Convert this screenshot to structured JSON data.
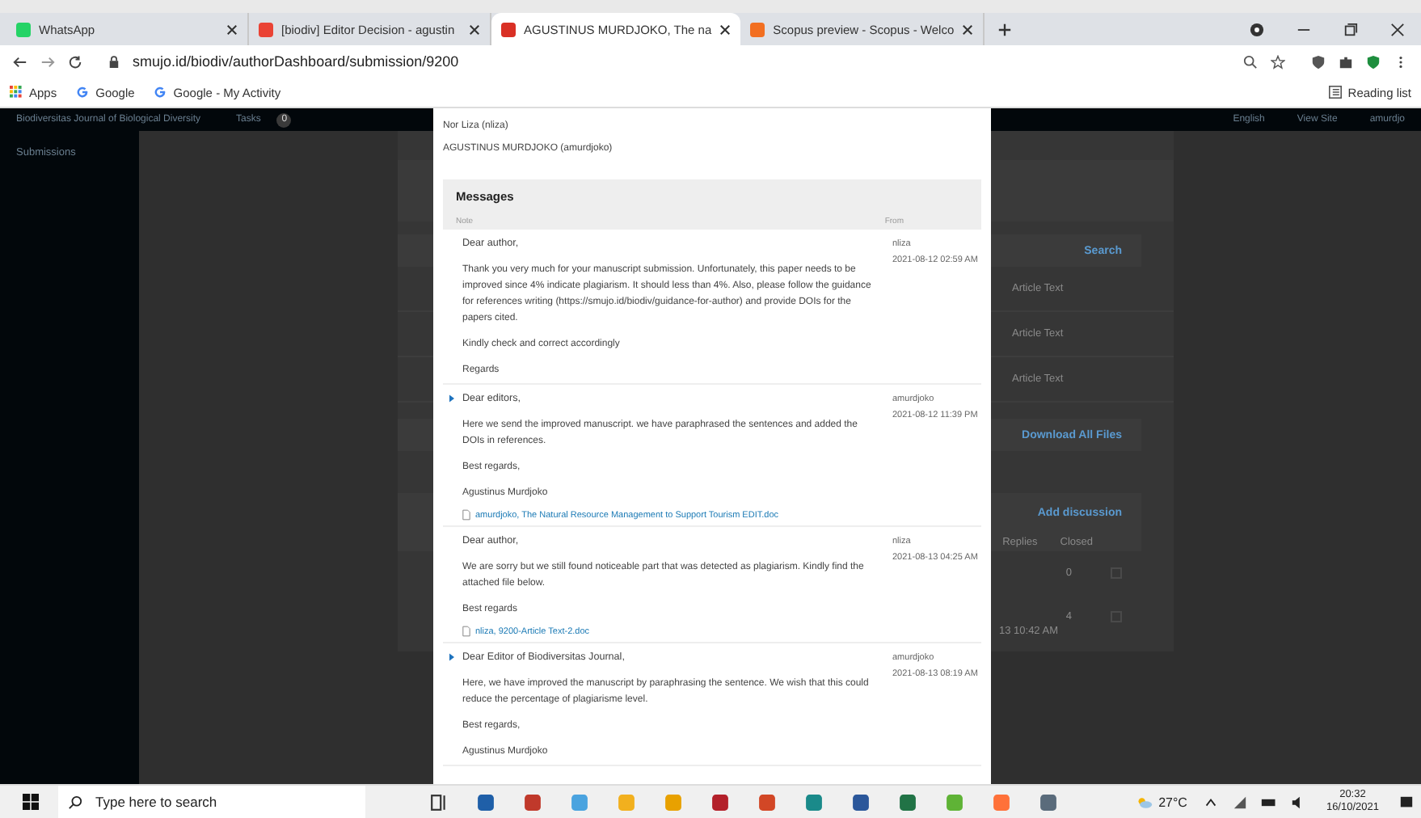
{
  "browser": {
    "tabs": [
      {
        "title": "WhatsApp",
        "kind": "whatsapp",
        "selected": false
      },
      {
        "title": "[biodiv] Editor Decision - agustin",
        "kind": "gmail",
        "selected": false
      },
      {
        "title": "AGUSTINUS MURDJOKO, The na",
        "kind": "site",
        "selected": true
      },
      {
        "title": "Scopus preview - Scopus - Welco",
        "kind": "scopus",
        "selected": false
      }
    ],
    "url": "smujo.id/biodiv/authorDashboard/submission/9200",
    "bookmarks": [
      {
        "label": "Apps",
        "kind": "apps"
      },
      {
        "label": "Google",
        "kind": "google"
      },
      {
        "label": "Google - My Activity",
        "kind": "google"
      }
    ],
    "reading_list": "Reading list"
  },
  "background_page": {
    "journal": "Biodiversitas Journal of Biological Diversity",
    "tasks_label": "Tasks",
    "tasks_count": "0",
    "nav_item": "Submissions",
    "header_links": [
      "English",
      "View Site",
      "amurdjo"
    ],
    "search": "Search",
    "files": [
      "Article Text",
      "Article Text",
      "Article Text"
    ],
    "download": "Download All Files",
    "add_discussion": "Add discussion",
    "columns": [
      "Replies",
      "Closed"
    ],
    "discussions": [
      {
        "replies": "0",
        "closed": false
      },
      {
        "replies": "4",
        "closed": false,
        "date": "13 10:42 AM"
      }
    ]
  },
  "modal": {
    "participants": [
      "Nor Liza (nliza)",
      "AGUSTINUS MURDJOKO (amurdjoko)"
    ],
    "title": "Messages",
    "columns": [
      "Note",
      "From"
    ],
    "messages": [
      {
        "unread": false,
        "paragraphs": [
          "Dear author,",
          "Thank you very much for your manuscript submission. Unfortunately, this paper needs to be improved since  4% indicate plagiarism. It should less than 4%. Also, please follow the guidance for references writing (https://smujo.id/biodiv/guidance-for-author) and provide DOIs for the papers cited.",
          "Kindly check and correct accordingly",
          "Regards"
        ],
        "from": "nliza",
        "date": "2021-08-12 02:59 AM"
      },
      {
        "unread": true,
        "paragraphs": [
          "Dear editors,",
          "Here we send the improved manuscript.  we have paraphrased the sentences and added the DOIs in references.",
          "Best regards,",
          "Agustinus Murdjoko"
        ],
        "attachment": "amurdjoko, The Natural Resource Management to Support Tourism EDIT.doc",
        "from": "amurdjoko",
        "date": "2021-08-12 11:39 PM"
      },
      {
        "unread": false,
        "paragraphs": [
          "Dear author,",
          "We are sorry but we still found noticeable part that was detected as plagiarism. Kindly find the attached file below.",
          "Best regards"
        ],
        "attachment": "nliza, 9200-Article Text-2.doc",
        "from": "nliza",
        "date": "2021-08-13 04:25 AM"
      },
      {
        "unread": true,
        "paragraphs": [
          "Dear Editor of Biodiversitas Journal,",
          "Here, we have improved the manuscript by paraphrasing the sentence.  We wish that this could reduce the percentage of plagiarisme level.",
          "Best regards,",
          "Agustinus Murdjoko"
        ],
        "from": "amurdjoko",
        "date": "2021-08-13 08:19 AM"
      }
    ]
  },
  "taskbar": {
    "search_placeholder": "Type here to search",
    "weather": "27°C",
    "time": "20:32",
    "date": "16/10/2021"
  }
}
